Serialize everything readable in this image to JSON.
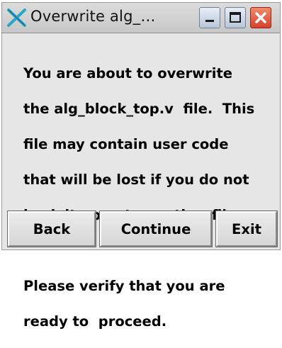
{
  "window": {
    "title": "Overwrite alg_…",
    "icon": "x-cross-icon",
    "controls": [
      "minimize",
      "maximize",
      "close"
    ]
  },
  "message": {
    "lines": [
      "You are about to overwrite",
      "the alg_block_top.v  file.  This",
      "file may contain user code",
      "that will be lost if you do not",
      "back it up onto another file."
    ],
    "lines2": [
      "Please verify that you are",
      "ready to  proceed."
    ]
  },
  "buttons": {
    "back": "Back",
    "continue": "Continue",
    "exit": "Exit"
  }
}
